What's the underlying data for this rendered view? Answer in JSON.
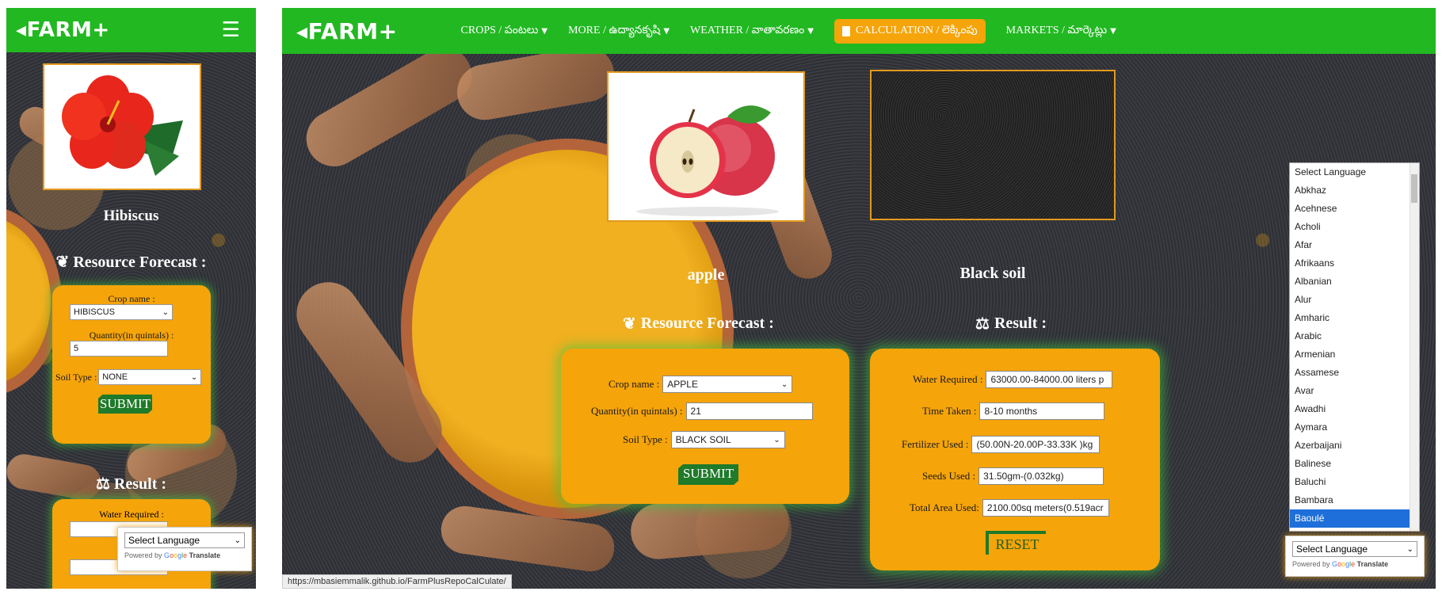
{
  "mobile": {
    "logo": "FARM+",
    "crop_image_label": "Hibiscus",
    "forecast_title": "Resource Forecast :",
    "form": {
      "crop_label": "Crop name :",
      "crop_value": "HIBISCUS",
      "quantity_label": "Quantity(in quintals) :",
      "quantity_value": "5",
      "soil_label": "Soil Type :",
      "soil_value": "NONE",
      "submit_label": "SUBMIT"
    },
    "result_title": "Result :",
    "result": {
      "water_label": "Water Required :",
      "time_label_partial": "Ti"
    },
    "language_widget": {
      "selected": "Select Language",
      "powered_by": "Powered by",
      "translate": "Translate"
    }
  },
  "desktop": {
    "logo": "FARM+",
    "nav": [
      {
        "label": "CROPS / పంటలు"
      },
      {
        "label": "MORE / ఉద్యానకృషి"
      },
      {
        "label": "WEATHER / వాతావరణం"
      },
      {
        "label": "CALCULATION / లెక్కింపు"
      },
      {
        "label": "MARKETS / మార్కెట్లు"
      }
    ],
    "crop_label": "apple",
    "soil_label": "Black soil",
    "forecast_title": "Resource Forecast :",
    "result_title": "Result :",
    "form": {
      "crop_label": "Crop name :",
      "crop_value": "APPLE",
      "quantity_label": "Quantity(in quintals) :",
      "quantity_value": "21",
      "soil_label": "Soil Type :",
      "soil_value": "BLACK SOIL",
      "submit_label": "SUBMIT"
    },
    "result": {
      "water_label": "Water Required :",
      "water_value": "63000.00-84000.00 liters p",
      "time_label": "Time Taken :",
      "time_value": "8-10 months",
      "fertilizer_label": "Fertilizer Used :",
      "fertilizer_value": "(50.00N-20.00P-33.33K )kg",
      "seeds_label": "Seeds Used :",
      "seeds_value": "31.50gm-(0.032kg)",
      "area_label": "Total Area Used:",
      "area_value": "2100.00sq meters(0.519acr",
      "reset_label": "RESET"
    },
    "language_options": [
      "Select Language",
      "Abkhaz",
      "Acehnese",
      "Acholi",
      "Afar",
      "Afrikaans",
      "Albanian",
      "Alur",
      "Amharic",
      "Arabic",
      "Armenian",
      "Assamese",
      "Avar",
      "Awadhi",
      "Aymara",
      "Azerbaijani",
      "Balinese",
      "Baluchi",
      "Bambara",
      "Baoulé"
    ],
    "language_selected_index": 19,
    "language_widget": {
      "selected": "Select Language",
      "powered_by": "Powered by",
      "translate": "Translate"
    },
    "status_url": "https://mbasiemmalik.github.io/FarmPlusRepoCalCulate/"
  }
}
